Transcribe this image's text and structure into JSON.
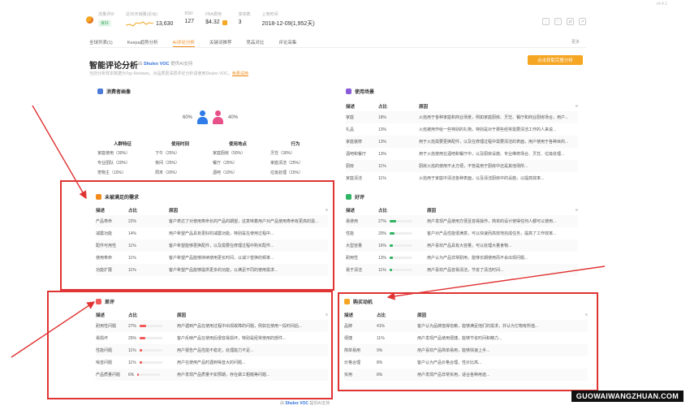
{
  "version": "v4.4.1",
  "header": {
    "metrics": [
      {
        "label": "流量评价",
        "value": "良好",
        "type": "tag"
      },
      {
        "label": "近30天销量(近似)",
        "value": "13,630",
        "type": "spark"
      },
      {
        "label": "BSR",
        "value": "127"
      },
      {
        "label": "FBA费用",
        "value": "$4.32"
      },
      {
        "label": "变体数",
        "value": "3"
      },
      {
        "label": "上架时间",
        "value": "2018-12-09(1,952天)"
      }
    ],
    "icons": [
      "more-icon",
      "heart-icon",
      "compare-icon",
      "share-icon"
    ]
  },
  "tabs": {
    "items": [
      "全球列表(1)",
      "Keepa趋势分析",
      "AI评论分析",
      "关键词推荐",
      "竞品对比",
      "评论采集"
    ],
    "active_index": 2,
    "more": "更多"
  },
  "title": {
    "text": "智能评论分析",
    "powered_prefix": "由",
    "powered_brand": "Shulex VOC",
    "powered_suffix": "提供AI支持",
    "subtitle": "当前分析样本数据为Top Reviews，对品质更深层评论分析请使用Shulex VOC，",
    "subtitle_link": "免费试用",
    "cta": "点击获取完整分析"
  },
  "consumer": {
    "title": "消费者画像",
    "female_pct": "60%",
    "male_pct": "40%",
    "columns": [
      {
        "header": "人群特征",
        "rows": [
          "家庭使用（30%）",
          "专业团队（20%）",
          "宠物主（10%）"
        ]
      },
      {
        "header": "使用时刻",
        "rows": [
          "下午（25%）",
          "夜间（25%）",
          "周末（20%）"
        ]
      },
      {
        "header": "使用地点",
        "rows": [
          "家庭厨房（50%）",
          "餐厅（25%）",
          "酒吧（10%）"
        ]
      },
      {
        "header": "行为",
        "rows": [
          "烹饪（30%）",
          "家庭清洁（25%）",
          "垃圾处理（15%）"
        ]
      }
    ]
  },
  "scenario": {
    "title": "使用场景",
    "headers": [
      "描述",
      "占比",
      "原因"
    ],
    "rows": [
      [
        "家庭",
        "18%",
        "火焰用于各种家庭和商业场景，例如家庭厨房、烹饪、餐厅和商业厨房场合，用户..."
      ],
      [
        "礼品",
        "13%",
        "火焰被用作给一些特别的礼物，特别是对于那些经常需要清洁工作的人来说..."
      ],
      [
        "家庭装修",
        "13%",
        "用于火焰需要更换配件，以及在修理过程中需要清洁的表面，用户使用于各种目的..."
      ],
      [
        "酒吧和餐厅",
        "13%",
        "用于火焰使用在酒吧和餐厅中，以及厨房设施、专业维修场合、烹饪、垃圾处理..."
      ],
      [
        "厨房",
        "11%",
        "厨房火焰的使用不太方便，不管是用于厨房中还是其他场所..."
      ],
      [
        "家庭清洁",
        "11%",
        "火焰用于家庭中清洁各种表面，以及清洁厨房中的设施，以提高效率..."
      ]
    ]
  },
  "unmet": {
    "title": "未被满足的需求",
    "headers": [
      "描述",
      "占比",
      "原因"
    ],
    "rows": [
      [
        "产品寿命",
        "22%",
        "客户表达了对使用寿命长的产品的期望，这意味着用户对产品使用寿命有更高的需求..."
      ],
      [
        "减震功能",
        "14%",
        "用户希望产品具有更好的减震功能，特别是在使用过程中..."
      ],
      [
        "配件可用性",
        "11%",
        "客户希望能够更换配件，以及需要在修理过程中购买配件..."
      ],
      [
        "使用寿命",
        "11%",
        "客户希望产品能够持续使用更长时间，以减少替换的频率..."
      ],
      [
        "功能扩展",
        "11%",
        "客户希望产品能够提供更多的功能，以满足不同的使用需求..."
      ]
    ]
  },
  "positive": {
    "title": "好评",
    "headers": [
      "描述",
      "占比",
      "原因"
    ],
    "rows": [
      [
        "易使用",
        "27%",
        0.27,
        "用户发现产品使用方便且容易操作，简单的设计使得任何人都可以使用..."
      ],
      [
        "性能",
        "20%",
        0.2,
        "客户对产品性能很满意，可以快速而高效地完成任务，提高了工作效率..."
      ],
      [
        "大型容量",
        "16%",
        0.16,
        "用户喜欢产品具有大容量，可以处理大量食物..."
      ],
      [
        "耐用性",
        "13%",
        0.13,
        "用户认为产品非常耐用，能够长期使用而不会出现问题..."
      ],
      [
        "易于清洁",
        "11%",
        0.11,
        "用户喜欢产品容易清洁，节省了清洁时间..."
      ]
    ]
  },
  "negative": {
    "title": "差评",
    "headers": [
      "描述",
      "占比",
      "原因"
    ],
    "rows": [
      [
        "耐用性问题",
        "27%",
        0.27,
        "用户遇到产品在使用过程中出现故障的问题，例如在使用一段时间后..."
      ],
      [
        "易损坏",
        "25%",
        0.25,
        "客户反映产品在使用后很容易损坏，特别是经常使用的部件..."
      ],
      [
        "性能问题",
        "11%",
        0.11,
        "用户报告产品性能不稳定，处理能力不足..."
      ],
      [
        "噪音问题",
        "11%",
        0.11,
        "用户在使用产品时遇到噪音大的问题..."
      ],
      [
        "产品质量问题",
        "6%",
        0.06,
        "用户发现产品质量不如预期，存在做工粗糙等问题..."
      ]
    ]
  },
  "purchase": {
    "title": "购买动机",
    "headers": [
      "描述",
      "占比",
      "原因"
    ],
    "rows": [
      [
        "品牌",
        "41%",
        "客户认为品牌值得信赖，能够满足他们的需求，并认为它物有所值..."
      ],
      [
        "便捷",
        "11%",
        "用户发现产品使用便捷，能够节省时间和精力..."
      ],
      [
        "简单易用",
        "9%",
        "用户喜欢产品简单易用，能够快速上手..."
      ],
      [
        "价格合理",
        "8%",
        "客户认为产品价格合理，性价比高..."
      ],
      [
        "实用",
        "8%",
        "用户发现产品非常实用，适合各种用途..."
      ]
    ]
  },
  "footer": {
    "prefix": "由",
    "brand": "Shulex VOC",
    "suffix": "提供AI支持"
  },
  "watermark": "GUOWAIWANGZHUAN.COM",
  "colors": {
    "accent": "#f28b1b",
    "positive_bar": "#2fb463",
    "negative_bar": "#f25a5a",
    "annotation": "#e03333"
  }
}
